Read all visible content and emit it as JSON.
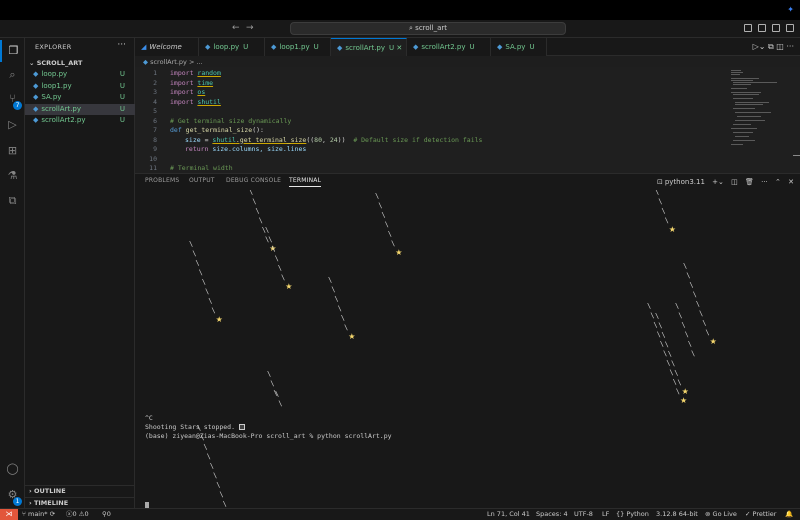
{
  "title": {
    "command_center": "scroll_art"
  },
  "activity": {
    "scm_badge": "7",
    "accounts_badge": "1"
  },
  "sidebar": {
    "header": "EXPLORER",
    "more": "···",
    "folder": "SCROLL_ART",
    "files": [
      {
        "name": "loop.py",
        "status": "U"
      },
      {
        "name": "loop1.py",
        "status": "U"
      },
      {
        "name": "SA.py",
        "status": "U"
      },
      {
        "name": "scrollArt.py",
        "status": "U"
      },
      {
        "name": "scrollArt2.py",
        "status": "U"
      }
    ],
    "outline": "OUTLINE",
    "timeline": "TIMELINE"
  },
  "tabs": [
    {
      "name": "Welcome",
      "status": ""
    },
    {
      "name": "loop.py",
      "status": "U"
    },
    {
      "name": "loop1.py",
      "status": "U"
    },
    {
      "name": "scrollArt.py",
      "status": "U"
    },
    {
      "name": "scrollArt2.py",
      "status": "U"
    },
    {
      "name": "SA.py",
      "status": "U"
    }
  ],
  "breadcrumb": {
    "file": "scrollArt.py",
    "rest": "> ..."
  },
  "code": {
    "line_numbers": [
      "1",
      "2",
      "3",
      "4",
      "5",
      "6",
      "7",
      "8",
      "9",
      "10",
      "11"
    ],
    "import_kw": "import",
    "modules": [
      "random",
      "time",
      "os",
      "shutil"
    ],
    "comment1": "# Get terminal size dynamically",
    "def_kw": "def",
    "func_name": "get_terminal_size",
    "func_paren": "():",
    "size_var": "size",
    "assign": " = ",
    "call_mod": "shutil",
    "call_fn": ".get_terminal_size",
    "open_paren": "((",
    "arg1": "80",
    "comma": ", ",
    "arg2": "24",
    "close_paren": "))",
    "comment2": "# Default size if detection fails",
    "return_kw": "return",
    "ret_expr": " size.columns, size.lines",
    "comment3": "# Terminal width"
  },
  "panel": {
    "tabs": [
      "PROBLEMS",
      "OUTPUT",
      "DEBUG CONSOLE",
      "TERMINAL"
    ],
    "shell": "python3.11",
    "term_lines": {
      "interrupt": "^C",
      "stopped": "Shooting Stars stopped.",
      "prompt": "(base) ziyean@Zias-MacBook-Pro scroll_art % python scrollArt.py"
    }
  },
  "status": {
    "branch": "main*",
    "errors": "0",
    "warnings": "0",
    "ports": "0",
    "position": "Ln 71, Col 41",
    "spaces": "Spaces: 4",
    "encoding": "UTF-8",
    "eol": "LF",
    "language": "Python",
    "interpreter": "3.12.8 64-bit",
    "golive": "Go Live",
    "prettier": "Prettier"
  },
  "colors": {
    "accent": "#0078d4",
    "untracked": "#73c991",
    "star": "#f5d76e",
    "remote": "#e2563b"
  }
}
